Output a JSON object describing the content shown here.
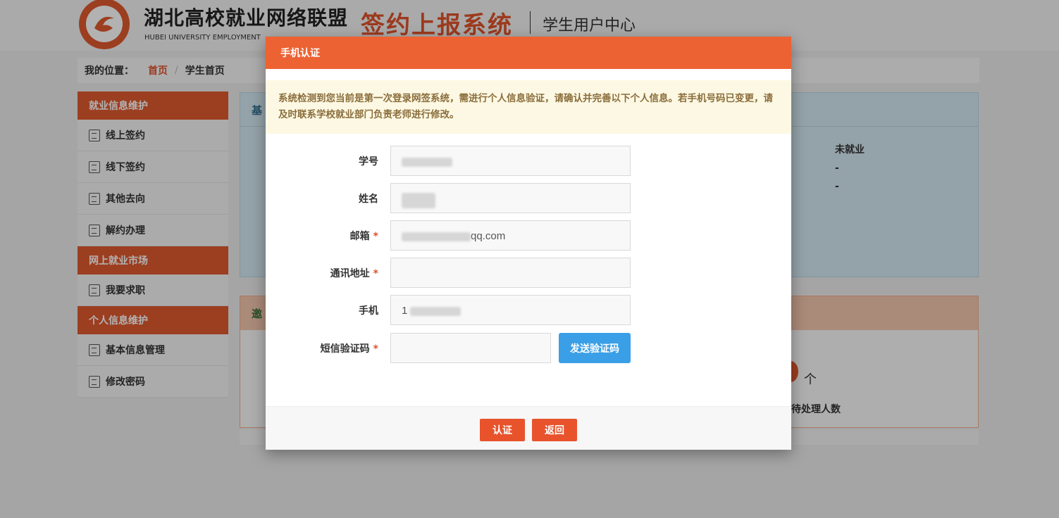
{
  "header": {
    "site_title": "湖北高校就业网络联盟",
    "site_subtitle": "HUBEI UNIVERSITY EMPLOYMENT",
    "system_title": "签约上报系统",
    "user_center": "学生用户中心"
  },
  "breadcrumb": {
    "label": "我的位置：",
    "home": "首页",
    "separator": "/",
    "current": "学生首页"
  },
  "sidebar": {
    "groups": [
      {
        "title": "就业信息维护",
        "items": [
          "线上签约",
          "线下签约",
          "其他去向",
          "解约办理"
        ]
      },
      {
        "title": "网上就业市场",
        "items": [
          "我要求职"
        ]
      },
      {
        "title": "个人信息维护",
        "items": [
          "基本信息管理",
          "修改密码"
        ]
      }
    ]
  },
  "background": {
    "info_panel_title": "基",
    "status_value": "未就业",
    "dash1": "-",
    "dash2": "-",
    "invite_panel_title": "邀",
    "count_unit": "个",
    "pending_label": "待处理人数"
  },
  "modal": {
    "title": "手机认证",
    "notice": "系统检测到您当前是第一次登录网签系统，需进行个人信息验证，请确认并完善以下个人信息。若手机号码已变更，请及时联系学校就业部门负责老师进行修改。",
    "fields": {
      "student_id": {
        "label": "学号"
      },
      "name": {
        "label": "姓名"
      },
      "email": {
        "label": "邮箱",
        "required_mark": "*",
        "value_suffix": "qq.com"
      },
      "address": {
        "label": "通讯地址",
        "required_mark": "*",
        "value": ""
      },
      "phone": {
        "label": "手机",
        "value_prefix": "1"
      },
      "sms_code": {
        "label": "短信验证码",
        "required_mark": "*",
        "value": ""
      }
    },
    "send_code_button": "发送验证码",
    "confirm_button": "认证",
    "back_button": "返回"
  },
  "colors": {
    "brand_orange": "#ec6232",
    "button_blue": "#3a9fe6",
    "notice_bg": "#fcf8e3",
    "notice_text": "#8a6d3b",
    "required_red": "#e0532b"
  }
}
